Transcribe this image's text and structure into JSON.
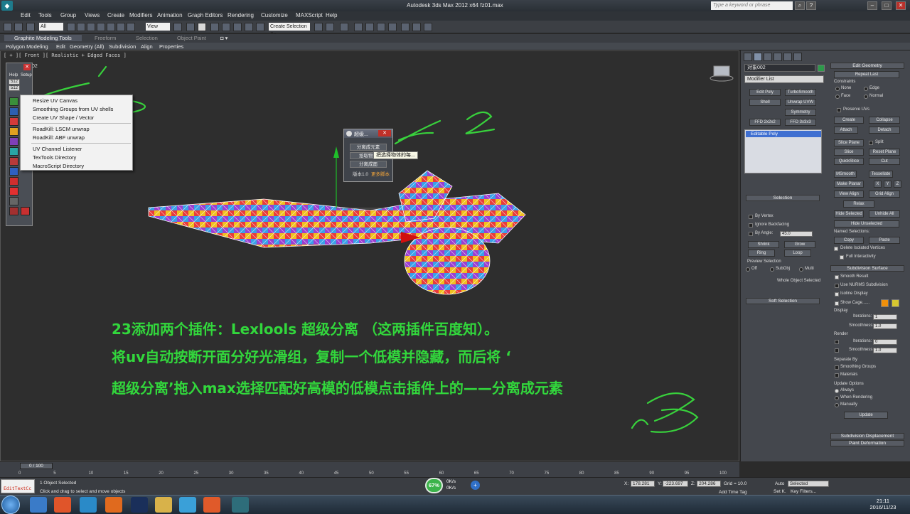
{
  "window": {
    "title": "Autodesk 3ds Max  2012 x64      fz01.max",
    "search_placeholder": "Type a keyword or phrase",
    "app_icon": "3ds-max-logo"
  },
  "menu": [
    "Edit",
    "Tools",
    "Group",
    "Views",
    "Create",
    "Modifiers",
    "Animation",
    "Graph Editors",
    "Rendering",
    "Customize",
    "MAXScript",
    "Help"
  ],
  "toolbar": {
    "filter_value": "All",
    "view_value": "View",
    "selection_set_placeholder": "Create Selection Se"
  },
  "ribbon": {
    "tabs": [
      "Graphite Modeling Tools",
      "Freeform",
      "Selection",
      "Object Paint"
    ],
    "subtabs": [
      "Polygon Modeling",
      "Edit",
      "Geometry (All)",
      "Subdivision",
      "Align",
      "Properties"
    ]
  },
  "viewport": {
    "label": "[ + ][ Front ][ Realistic + Edged Faces ]",
    "object_name": "02"
  },
  "floater": {
    "help": "Help",
    "setup": "Setup",
    "field1": "512",
    "field2": "512"
  },
  "context_menu": [
    "Resize UV Canvas",
    "Smoothing Groups from UV shells",
    "Create UV Shape / Vector",
    "RoadKill: LSCM unwrap",
    "RoadKill: ABF unwrap",
    "UV Channel Listener",
    "TexTools Directory",
    "MacroScript Directory"
  ],
  "dialog": {
    "title": "超级...",
    "close": "✕",
    "btn1": "分离成元素",
    "btn2": "拾取物体",
    "btn3": "分离成面",
    "version": "版本1.0",
    "more": "更多脚本",
    "tooltip": "把选择物体的每..."
  },
  "annotation": {
    "line1": "23添加两个插件：Lexlools  超级分离 （这两插件百度知）。",
    "line2": "将uv自动按断开面分好光滑组，复制一个低模并隐藏，而后将 ‘",
    "line3": "超级分离’拖入max选择匹配好高模的低模点击插件上的——分离成元素"
  },
  "command_panel": {
    "object_name": "对象002",
    "modifier_list": "Modifier List",
    "modifier_buttons": [
      "Edit Poly",
      "TurboSmooth",
      "Shell",
      "Unwrap UVW",
      "Symmetry",
      "FFD 2x2x2",
      "FFD 3x3x3"
    ],
    "stack_item": "Editable Poly",
    "selection_header": "Selection",
    "by_vertex": "By Vertex",
    "ignore_backfacing": "Ignore Backfacing",
    "by_angle": "By Angle:",
    "angle_value": "45.0",
    "shrink": "Shrink",
    "grow": "Grow",
    "ring": "Ring",
    "loop": "Loop",
    "preview_selection": "Preview Selection",
    "off": "Off",
    "subobj": "SubObj",
    "multi": "Multi",
    "whole_object": "Whole Object Selected",
    "soft_selection": "Soft Selection",
    "edit_geometry": "Edit Geometry",
    "repeat_last": "Repeat Last",
    "constraints": "Constraints",
    "none": "None",
    "edge": "Edge",
    "face": "Face",
    "normal": "Normal",
    "preserve_uvs": "Preserve UVs",
    "create": "Create",
    "collapse": "Collapse",
    "attach": "Attach",
    "detach": "Detach",
    "slice_plane": "Slice Plane",
    "split": "Split",
    "slice": "Slice",
    "reset_plane": "Reset Plane",
    "quickslice": "QuickSlice",
    "cut": "Cut",
    "msmooth": "MSmooth",
    "tessellate": "Tessellate",
    "make_planar": "Make Planar",
    "x": "X",
    "y": "Y",
    "z": "Z",
    "view_align": "View Align",
    "grid_align": "Grid Align",
    "relax": "Relax",
    "hide_selected": "Hide Selected",
    "unhide_all": "Unhide All",
    "hide_unselected": "Hide Unselected",
    "named_selections": "Named Selections:",
    "copy": "Copy",
    "paste": "Paste",
    "delete_isolated": "Delete Isolated Vertices",
    "full_interactivity": "Full Interactivity",
    "subdivision_surface": "Subdivision Surface",
    "smooth_result": "Smooth Result",
    "use_nurms": "Use NURMS Subdivision",
    "isoline_display": "Isoline Display",
    "show_cage": "Show Cage......",
    "display": "Display",
    "iterations": "Iterations:",
    "iter_display": "1",
    "smoothness": "Smoothness:",
    "smooth_display": "1.0",
    "render": "Render",
    "iter_render": "0",
    "smooth_render": "1.0",
    "separate_by": "Separate By",
    "smoothing_groups": "Smoothing Groups",
    "materials": "Materials",
    "update_options": "Update Options",
    "always": "Always",
    "when_rendering": "When Rendering",
    "manually": "Manually",
    "update": "Update",
    "subdivision_displacement": "Subdivision Displacement",
    "paint_deformation": "Paint Deformation",
    "cage_color1": "#f0900a",
    "cage_color2": "#d8c830"
  },
  "timeline": {
    "slider": "0 / 100",
    "ticks": [
      "0",
      "5",
      "10",
      "15",
      "20",
      "25",
      "30",
      "35",
      "40",
      "45",
      "50",
      "55",
      "60",
      "65",
      "70",
      "75",
      "80",
      "85",
      "90",
      "95",
      "100"
    ]
  },
  "status": {
    "listener": "EditTextCc",
    "objects": "1 Object Selected",
    "prompt": "Click and drag to select and move objects",
    "x_label": "X:",
    "x": "178.281",
    "y_label": "Y:",
    "y": "-223.697",
    "z_label": "Z:",
    "z": "204.286",
    "grid": "Grid = 10.0",
    "add_time_tag": "Add Time Tag",
    "auto": "Auto",
    "set_key": "Set K.",
    "selected": "Selected",
    "key_filters": "Key Filters..."
  },
  "netmeter": {
    "percent": "67%",
    "up": "0K/s",
    "down": "0K/s"
  },
  "taskbar": {
    "time": "21:11",
    "date": "2016/11/23"
  }
}
